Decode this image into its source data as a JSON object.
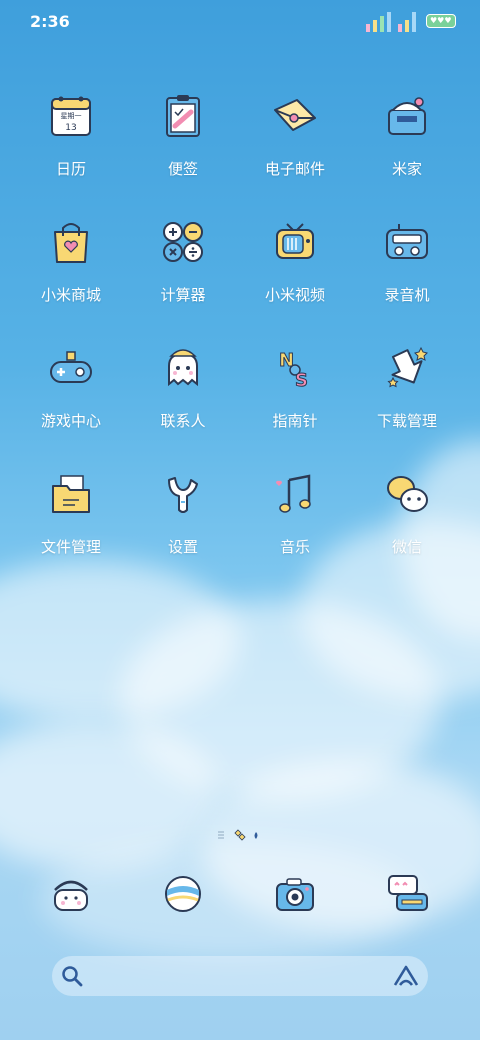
{
  "status_bar": {
    "time": "2:36",
    "battery_text": "♥♥♥"
  },
  "apps": [
    {
      "label": "日历",
      "icon": "calendar-icon",
      "calendar_line1": "星期一",
      "calendar_line2": "13"
    },
    {
      "label": "便签",
      "icon": "notes-icon"
    },
    {
      "label": "电子邮件",
      "icon": "email-icon"
    },
    {
      "label": "米家",
      "icon": "mihome-icon"
    },
    {
      "label": "小米商城",
      "icon": "shopping-bag-icon"
    },
    {
      "label": "计算器",
      "icon": "calculator-icon"
    },
    {
      "label": "小米视频",
      "icon": "tv-icon"
    },
    {
      "label": "录音机",
      "icon": "recorder-icon"
    },
    {
      "label": "游戏中心",
      "icon": "gamepad-icon"
    },
    {
      "label": "联系人",
      "icon": "contacts-ghost-icon"
    },
    {
      "label": "指南针",
      "icon": "compass-icon",
      "compass_n": "N",
      "compass_s": "S"
    },
    {
      "label": "下载管理",
      "icon": "download-icon"
    },
    {
      "label": "文件管理",
      "icon": "folder-icon"
    },
    {
      "label": "设置",
      "icon": "settings-icon"
    },
    {
      "label": "音乐",
      "icon": "music-note-icon"
    },
    {
      "label": "微信",
      "icon": "wechat-icon"
    }
  ],
  "dock": [
    {
      "icon": "phone-icon"
    },
    {
      "icon": "browser-ball-icon"
    },
    {
      "icon": "camera-icon"
    },
    {
      "icon": "messages-icon"
    }
  ],
  "colors": {
    "accent": "#2f5b9a",
    "outline": "#2b3a55",
    "yellow": "#f8d873",
    "blue": "#67b8ea"
  }
}
